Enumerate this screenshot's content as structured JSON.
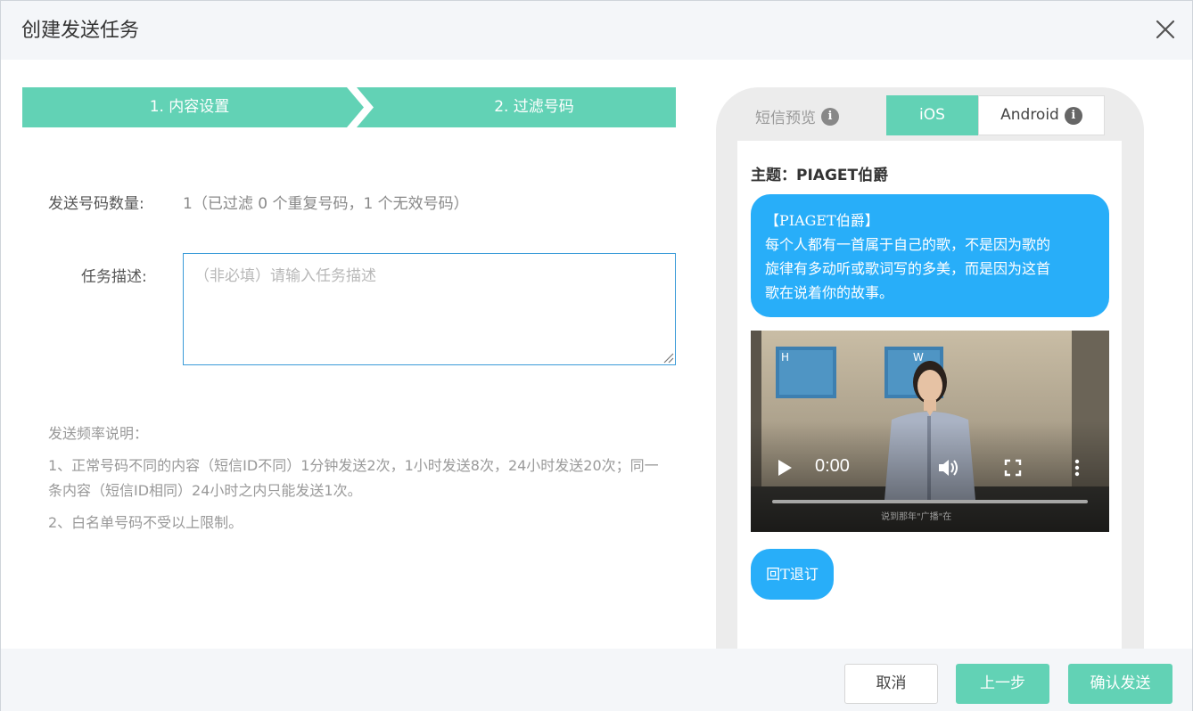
{
  "dialog": {
    "title": "创建发送任务"
  },
  "steps": [
    {
      "label": "1. 内容设置"
    },
    {
      "label": "2. 过滤号码"
    }
  ],
  "form": {
    "count_label": "发送号码数量:",
    "count_value": "1（已过滤 0 个重复号码，1 个无效号码）",
    "desc_label": "任务描述:",
    "desc_placeholder": "（非必填）请输入任务描述",
    "desc_value": ""
  },
  "notes": {
    "title": "发送频率说明：",
    "items": [
      "1、正常号码不同的内容（短信ID不同）1分钟发送2次，1小时发送8次，24小时发送20次；同一条内容（短信ID相同）24小时之内只能发送1次。",
      "2、白名单号码不受以上限制。"
    ]
  },
  "preview": {
    "label": "短信预览",
    "tabs": [
      {
        "label": "iOS",
        "active": true
      },
      {
        "label": "Android",
        "active": false
      }
    ],
    "subject": "主题：PIAGET伯爵",
    "message_lines": [
      "【PIAGET伯爵】",
      "每个人都有一首属于自己的歌，不是因为歌的",
      "旋律有多动听或歌词写的多美，而是因为这首",
      "歌在说着你的故事。"
    ],
    "video": {
      "time": "0:00",
      "progress": 0,
      "subtitle": "说到那年\"广播\"在"
    },
    "unsubscribe": "回T退订"
  },
  "footer": {
    "cancel": "取消",
    "prev": "上一步",
    "confirm": "确认发送"
  },
  "colors": {
    "accent": "#62d2b5",
    "bubble": "#28aef9",
    "input_border": "#3a9bd8"
  }
}
